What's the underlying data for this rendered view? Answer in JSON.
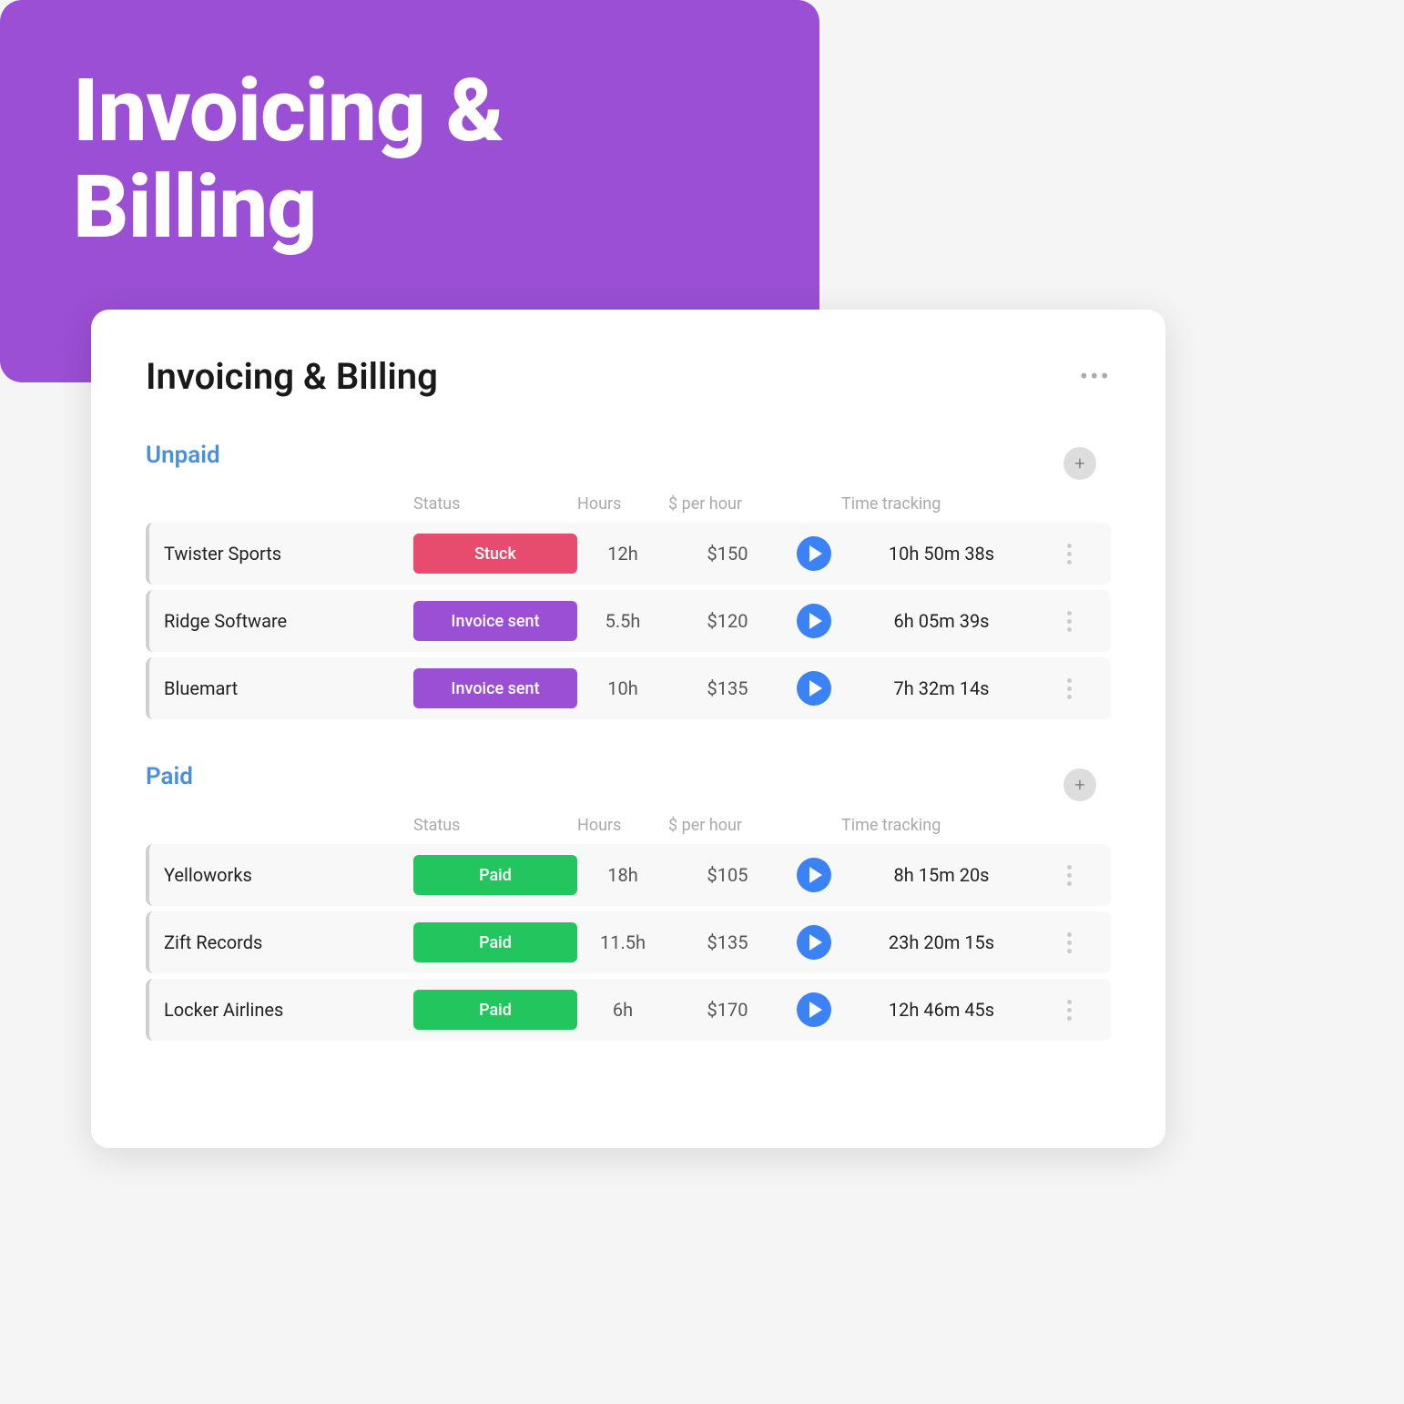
{
  "hero": {
    "title_line1": "Invoicing &",
    "title_line2": "Billing"
  },
  "card": {
    "title": "Invoicing & Billing",
    "more_icon": "•••"
  },
  "unpaid": {
    "section_title": "Unpaid",
    "columns": {
      "status": "Status",
      "hours": "Hours",
      "rate": "$ per hour",
      "tracking": "Time tracking"
    },
    "rows": [
      {
        "client": "Twister Sports",
        "status": "Stuck",
        "status_class": "status-stuck",
        "hours": "12h",
        "rate": "$150",
        "time": "10h 50m 38s"
      },
      {
        "client": "Ridge Software",
        "status": "Invoice sent",
        "status_class": "status-invoice",
        "hours": "5.5h",
        "rate": "$120",
        "time": "6h 05m 39s"
      },
      {
        "client": "Bluemart",
        "status": "Invoice sent",
        "status_class": "status-invoice",
        "hours": "10h",
        "rate": "$135",
        "time": "7h 32m 14s"
      }
    ]
  },
  "paid": {
    "section_title": "Paid",
    "columns": {
      "status": "Status",
      "hours": "Hours",
      "rate": "$ per hour",
      "tracking": "Time tracking"
    },
    "rows": [
      {
        "client": "Yelloworks",
        "status": "Paid",
        "status_class": "status-paid",
        "hours": "18h",
        "rate": "$105",
        "time": "8h 15m 20s"
      },
      {
        "client": "Zift Records",
        "status": "Paid",
        "status_class": "status-paid",
        "hours": "11.5h",
        "rate": "$135",
        "time": "23h 20m 15s"
      },
      {
        "client": "Locker Airlines",
        "status": "Paid",
        "status_class": "status-paid",
        "hours": "6h",
        "rate": "$170",
        "time": "12h 46m 45s"
      }
    ]
  }
}
